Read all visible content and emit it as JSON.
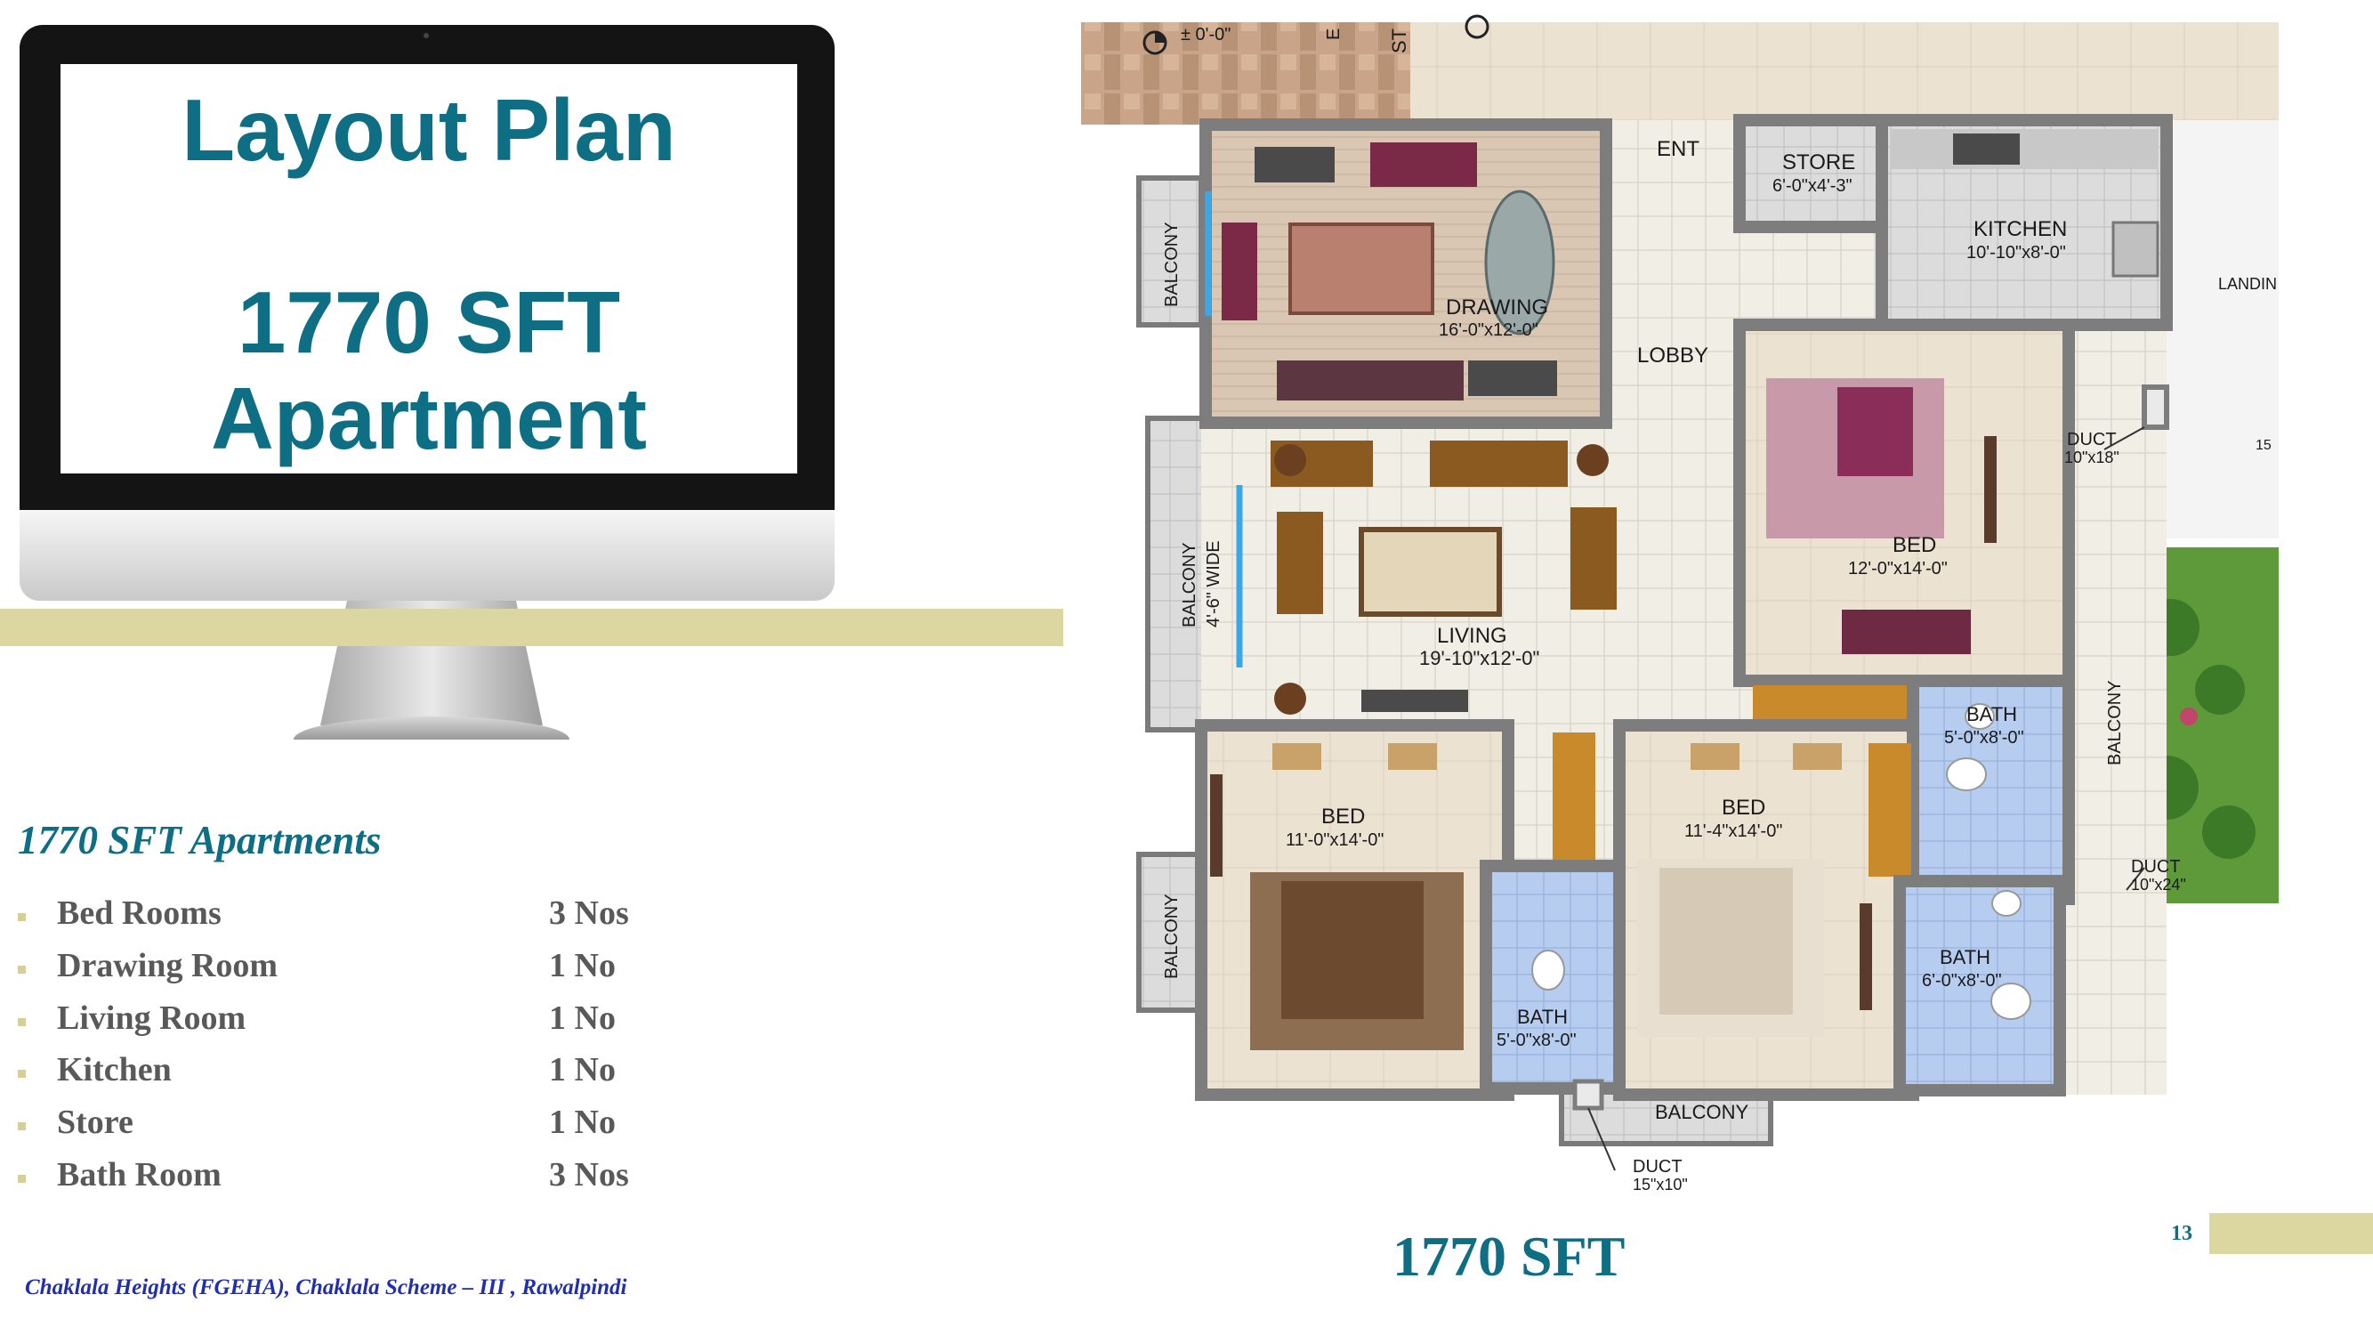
{
  "slide": {
    "title_line1": "Layout Plan",
    "title_line2": "1770 SFT",
    "title_line3": "Apartment",
    "page_number": "13",
    "footer": "Chaklala Heights (FGEHA), Chaklala Scheme – III , Rawalpindi",
    "plan_caption": "1770 SFT",
    "accent_color": "#0e6e83",
    "khaki_color": "#dcd7a0"
  },
  "specs": {
    "heading": "1770 SFT Apartments",
    "items": [
      {
        "label": "Bed Rooms",
        "value": "3 Nos"
      },
      {
        "label": "Drawing Room",
        "value": "1 No"
      },
      {
        "label": "Living Room",
        "value": "1 No"
      },
      {
        "label": "Kitchen",
        "value": "1 No"
      },
      {
        "label": "Store",
        "value": "1 No"
      },
      {
        "label": "Bath Room",
        "value": "3 Nos"
      }
    ]
  },
  "plan": {
    "level_mark": "± 0'-0\"",
    "st": "ST",
    "e": "E",
    "ent": "ENT",
    "store": {
      "name": "STORE",
      "size": "6'-0\"x4'-3\""
    },
    "kitchen": {
      "name": "KITCHEN",
      "size": "10'-10\"x8'-0\""
    },
    "landing": "LANDIN",
    "drawing": {
      "name": "DRAWING",
      "size": "16'-0\"x12'-0\""
    },
    "lobby": "LOBBY",
    "balcony": "BALCONY",
    "balcony_wide": "BALCONY",
    "balcony_wide_size": "4'-6\" WIDE",
    "living": {
      "name": "LIVING",
      "size": "19'-10\"x12'-0\""
    },
    "bed_master": {
      "name": "BED",
      "size": "12'-0\"x14'-0\""
    },
    "duct_top": {
      "name": "DUCT",
      "size": "10\"x18\""
    },
    "duct_right": {
      "name": "DUCT",
      "size": "10\"x24\""
    },
    "duct_bottom": {
      "name": "DUCT",
      "size": "15\"x10\""
    },
    "bath_master": {
      "name": "BATH",
      "size": "5'-0\"x8'-0\""
    },
    "bed_left": {
      "name": "BED",
      "size": "11'-0\"x14'-0\""
    },
    "bed_mid": {
      "name": "BED",
      "size": "11'-4\"x14'-0\""
    },
    "bath_left": {
      "name": "BATH",
      "size": "5'-0\"x8'-0\""
    },
    "bath_right": {
      "name": "BATH",
      "size": "6'-0\"x8'-0\""
    },
    "stair_15": "15"
  }
}
